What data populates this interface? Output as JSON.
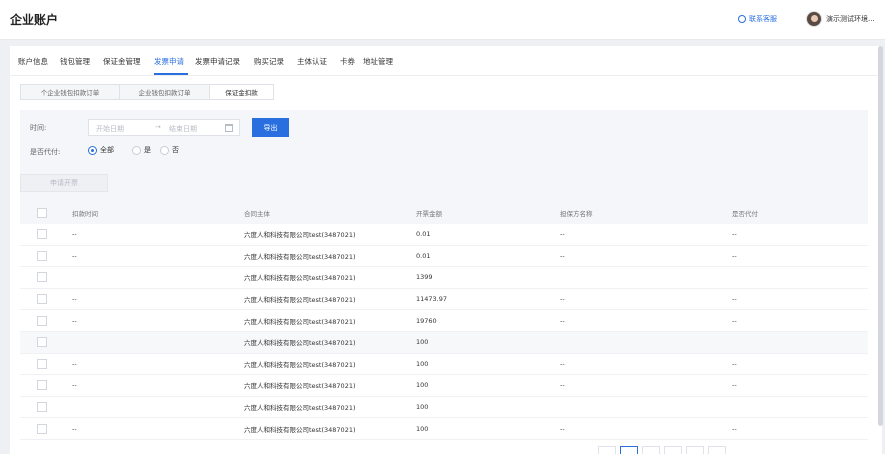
{
  "header": {
    "title": "企业账户",
    "customer_service": "联系客服",
    "user_name": "演示测试环境..."
  },
  "tabs": [
    "账户信息",
    "钱包管理",
    "保证金管理",
    "发票申请",
    "发票申请记录",
    "购买记录",
    "主体认证",
    "卡券",
    "地址管理"
  ],
  "active_tab": "发票申请",
  "subtabs": [
    "个企业钱包扣款订单",
    "企业钱包扣款订单",
    "保证金扣款"
  ],
  "active_subtab": "保证金扣款",
  "filter": {
    "time_label": "时间:",
    "start_placeholder": "开始日期",
    "arrow": "→",
    "end_placeholder": "结束日期",
    "export_label": "导出",
    "agent_label": "是否代付:",
    "options": [
      "全部",
      "是",
      "否"
    ],
    "selected": "全部"
  },
  "apply_button": "申请开票",
  "table": {
    "columns": [
      "扣款时间",
      "合同主体",
      "开票金额",
      "担保方名称",
      "是否代付"
    ],
    "rows": [
      [
        "--",
        "六度人和科技有限公司test(3487021)",
        "0.01",
        "--",
        "--"
      ],
      [
        "--",
        "六度人和科技有限公司test(3487021)",
        "0.01",
        "--",
        "--"
      ],
      [
        "",
        "六度人和科技有限公司test(3487021)",
        "1399",
        "",
        ""
      ],
      [
        "--",
        "六度人和科技有限公司test(3487021)",
        "11473.97",
        "--",
        "--"
      ],
      [
        "--",
        "六度人和科技有限公司test(3487021)",
        "19760",
        "--",
        "--"
      ],
      [
        "",
        "六度人和科技有限公司test(3487021)",
        "100",
        "",
        ""
      ],
      [
        "--",
        "六度人和科技有限公司test(3487021)",
        "100",
        "--",
        "--"
      ],
      [
        "--",
        "六度人和科技有限公司test(3487021)",
        "100",
        "--",
        "--"
      ],
      [
        "",
        "六度人和科技有限公司test(3487021)",
        "100",
        "",
        ""
      ],
      [
        "--",
        "六度人和科技有限公司test(3487021)",
        "100",
        "--",
        "--"
      ]
    ]
  },
  "colors": {
    "accent": "#2a6fe0"
  }
}
